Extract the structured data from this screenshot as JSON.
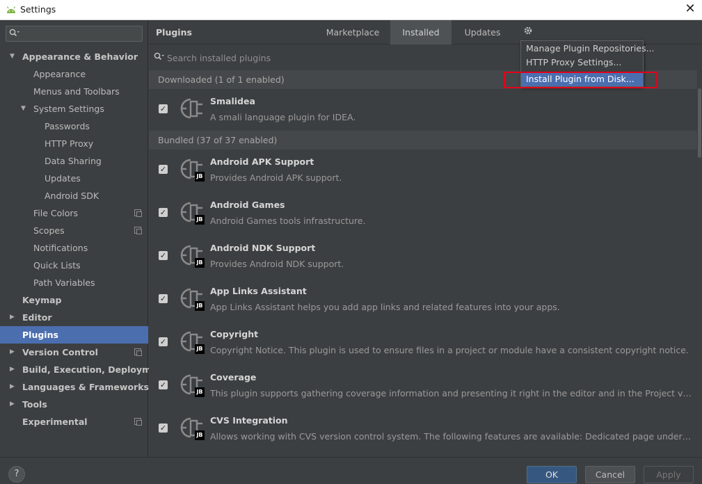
{
  "window": {
    "title": "Settings",
    "close_glyph": "✕"
  },
  "sidebar": {
    "search_placeholder": "",
    "items": [
      {
        "label": "Appearance & Behavior",
        "level": 0,
        "arrow": "▼",
        "bold": true
      },
      {
        "label": "Appearance",
        "level": 1
      },
      {
        "label": "Menus and Toolbars",
        "level": 1
      },
      {
        "label": "System Settings",
        "level": 1,
        "arrow": "▼"
      },
      {
        "label": "Passwords",
        "level": 2
      },
      {
        "label": "HTTP Proxy",
        "level": 2
      },
      {
        "label": "Data Sharing",
        "level": 2
      },
      {
        "label": "Updates",
        "level": 2
      },
      {
        "label": "Android SDK",
        "level": 2
      },
      {
        "label": "File Colors",
        "level": 1,
        "copy": true
      },
      {
        "label": "Scopes",
        "level": 1,
        "copy": true
      },
      {
        "label": "Notifications",
        "level": 1
      },
      {
        "label": "Quick Lists",
        "level": 1
      },
      {
        "label": "Path Variables",
        "level": 1
      },
      {
        "label": "Keymap",
        "level": 0,
        "bold": true
      },
      {
        "label": "Editor",
        "level": 0,
        "arrow": "▶",
        "bold": true
      },
      {
        "label": "Plugins",
        "level": 0,
        "bold": true,
        "selected": true
      },
      {
        "label": "Version Control",
        "level": 0,
        "arrow": "▶",
        "bold": true,
        "copy": true
      },
      {
        "label": "Build, Execution, Deployment",
        "level": 0,
        "arrow": "▶",
        "bold": true
      },
      {
        "label": "Languages & Frameworks",
        "level": 0,
        "arrow": "▶",
        "bold": true
      },
      {
        "label": "Tools",
        "level": 0,
        "arrow": "▶",
        "bold": true
      },
      {
        "label": "Experimental",
        "level": 0,
        "bold": true,
        "copy": true
      }
    ]
  },
  "main": {
    "title": "Plugins",
    "tabs": [
      {
        "label": "Marketplace"
      },
      {
        "label": "Installed",
        "active": true
      },
      {
        "label": "Updates"
      }
    ],
    "search_placeholder": "Search installed plugins",
    "downloaded_header": "Downloaded (1 of 1 enabled)",
    "downloaded": [
      {
        "name": "Smalidea",
        "desc": "A smali language plugin for IDEA.",
        "jb": false,
        "checked": true
      }
    ],
    "bundled_header": "Bundled (37 of 37 enabled)",
    "bundled": [
      {
        "name": "Android APK Support",
        "desc": "Provides Android APK support.",
        "jb": true,
        "checked": true
      },
      {
        "name": "Android Games",
        "desc": "Android Games tools infrastructure.",
        "jb": true,
        "checked": true
      },
      {
        "name": "Android NDK Support",
        "desc": "Provides Android NDK support.",
        "jb": true,
        "checked": true
      },
      {
        "name": "App Links Assistant",
        "desc": "App Links Assistant helps you add app links and related features into your apps.",
        "jb": true,
        "checked": true
      },
      {
        "name": "Copyright",
        "desc": "Copyright Notice. This plugin is used to ensure files in a project or module have a consistent copyright notice.",
        "jb": true,
        "checked": true
      },
      {
        "name": "Coverage",
        "desc": "This plugin supports gathering coverage information and presenting it right in the editor and in the Project view. The following...",
        "jb": true,
        "checked": true
      },
      {
        "name": "CVS Integration",
        "desc": "Allows working with CVS version control system. The following features are available: Dedicated page under the Version Control.",
        "jb": true,
        "checked": true
      }
    ],
    "jb_badge": "JB"
  },
  "gear_menu": {
    "items": [
      {
        "label": "Manage Plugin Repositories..."
      },
      {
        "label": "HTTP Proxy Settings..."
      },
      {
        "label": "Install Plugin from Disk...",
        "highlighted": true
      }
    ]
  },
  "footer": {
    "help": "?",
    "ok": "OK",
    "cancel": "Cancel",
    "apply": "Apply"
  },
  "colors": {
    "selection": "#4b6eaf",
    "highlight_box": "#e3001b",
    "primary_button": "#365880"
  }
}
